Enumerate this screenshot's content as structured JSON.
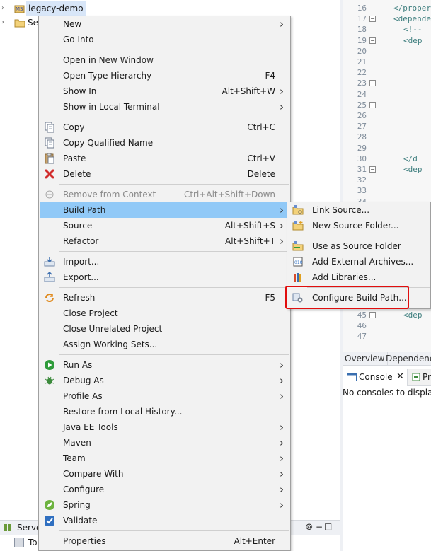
{
  "explorer": {
    "items": [
      {
        "label": "legacy-demo",
        "icon": "maven-project-icon"
      },
      {
        "label": "Se",
        "icon": "folder-icon"
      }
    ]
  },
  "editor": {
    "lines": [
      {
        "num": "16",
        "text": "</proper",
        "fold": false
      },
      {
        "num": "17",
        "text": "<depende",
        "fold": true
      },
      {
        "num": "18",
        "text": "<!--",
        "fold": false
      },
      {
        "num": "19",
        "text": "<dep",
        "fold": true
      },
      {
        "num": "20",
        "text": "",
        "fold": false
      },
      {
        "num": "21",
        "text": "",
        "fold": false
      },
      {
        "num": "22",
        "text": "",
        "fold": false
      },
      {
        "num": "23",
        "text": "",
        "fold": true
      },
      {
        "num": "24",
        "text": "",
        "fold": false
      },
      {
        "num": "25",
        "text": "",
        "fold": true
      },
      {
        "num": "26",
        "text": "",
        "fold": false
      },
      {
        "num": "27",
        "text": "",
        "fold": false
      },
      {
        "num": "28",
        "text": "",
        "fold": false
      },
      {
        "num": "29",
        "text": "",
        "fold": false
      },
      {
        "num": "30",
        "text": "</d",
        "fold": false
      },
      {
        "num": "31",
        "text": "<dep",
        "fold": true
      },
      {
        "num": "32",
        "text": "",
        "fold": false
      },
      {
        "num": "33",
        "text": "",
        "fold": false
      },
      {
        "num": "34",
        "text": "",
        "fold": false
      }
    ],
    "tail_lines": [
      {
        "num": "45",
        "text": "<dep",
        "fold": true
      },
      {
        "num": "46",
        "text": "",
        "fold": false
      },
      {
        "num": "47",
        "text": "",
        "fold": false
      }
    ],
    "tabs": [
      "Overview",
      "Dependencie"
    ]
  },
  "console": {
    "tab_label": "Console",
    "second_tab": "Pr",
    "message": "No consoles to display"
  },
  "bottom": {
    "tab_label": "Serve",
    "row_label": "To"
  },
  "context_menu": {
    "groups": [
      [
        {
          "label": "New",
          "accel": "",
          "submenu": true,
          "icon": ""
        },
        {
          "label": "Go Into",
          "accel": "",
          "submenu": false,
          "icon": ""
        }
      ],
      [
        {
          "label": "Open in New Window",
          "accel": "",
          "submenu": false,
          "icon": ""
        },
        {
          "label": "Open Type Hierarchy",
          "accel": "F4",
          "submenu": false,
          "icon": ""
        },
        {
          "label": "Show In",
          "accel": "Alt+Shift+W",
          "submenu": true,
          "icon": ""
        },
        {
          "label": "Show in Local Terminal",
          "accel": "",
          "submenu": true,
          "icon": ""
        }
      ],
      [
        {
          "label": "Copy",
          "accel": "Ctrl+C",
          "submenu": false,
          "icon": "copy-icon"
        },
        {
          "label": "Copy Qualified Name",
          "accel": "",
          "submenu": false,
          "icon": "copy-icon"
        },
        {
          "label": "Paste",
          "accel": "Ctrl+V",
          "submenu": false,
          "icon": "paste-icon"
        },
        {
          "label": "Delete",
          "accel": "Delete",
          "submenu": false,
          "icon": "delete-icon"
        }
      ],
      [
        {
          "label": "Remove from Context",
          "accel": "Ctrl+Alt+Shift+Down",
          "submenu": false,
          "icon": "remove-context-icon",
          "disabled": true
        },
        {
          "label": "Build Path",
          "accel": "",
          "submenu": true,
          "icon": "",
          "highlighted": true
        },
        {
          "label": "Source",
          "accel": "Alt+Shift+S",
          "submenu": true,
          "icon": ""
        },
        {
          "label": "Refactor",
          "accel": "Alt+Shift+T",
          "submenu": true,
          "icon": ""
        }
      ],
      [
        {
          "label": "Import...",
          "accel": "",
          "submenu": false,
          "icon": "import-icon"
        },
        {
          "label": "Export...",
          "accel": "",
          "submenu": false,
          "icon": "export-icon"
        }
      ],
      [
        {
          "label": "Refresh",
          "accel": "F5",
          "submenu": false,
          "icon": "refresh-icon"
        },
        {
          "label": "Close Project",
          "accel": "",
          "submenu": false,
          "icon": ""
        },
        {
          "label": "Close Unrelated Project",
          "accel": "",
          "submenu": false,
          "icon": ""
        },
        {
          "label": "Assign Working Sets...",
          "accel": "",
          "submenu": false,
          "icon": ""
        }
      ],
      [
        {
          "label": "Run As",
          "accel": "",
          "submenu": true,
          "icon": "run-icon"
        },
        {
          "label": "Debug As",
          "accel": "",
          "submenu": true,
          "icon": "debug-icon"
        },
        {
          "label": "Profile As",
          "accel": "",
          "submenu": true,
          "icon": ""
        },
        {
          "label": "Restore from Local History...",
          "accel": "",
          "submenu": false,
          "icon": ""
        },
        {
          "label": "Java EE Tools",
          "accel": "",
          "submenu": true,
          "icon": ""
        },
        {
          "label": "Maven",
          "accel": "",
          "submenu": true,
          "icon": ""
        },
        {
          "label": "Team",
          "accel": "",
          "submenu": true,
          "icon": ""
        },
        {
          "label": "Compare With",
          "accel": "",
          "submenu": true,
          "icon": ""
        },
        {
          "label": "Configure",
          "accel": "",
          "submenu": true,
          "icon": ""
        },
        {
          "label": "Spring",
          "accel": "",
          "submenu": true,
          "icon": "spring-icon"
        },
        {
          "label": "Validate",
          "accel": "",
          "submenu": false,
          "icon": "check-icon"
        }
      ],
      [
        {
          "label": "Properties",
          "accel": "Alt+Enter",
          "submenu": false,
          "icon": ""
        }
      ]
    ]
  },
  "build_path_submenu": {
    "groups": [
      [
        {
          "label": "Link Source...",
          "icon": "link-source-icon"
        },
        {
          "label": "New Source Folder...",
          "icon": "new-source-folder-icon"
        }
      ],
      [
        {
          "label": "Use as Source Folder",
          "icon": "use-source-folder-icon"
        },
        {
          "label": "Add External Archives...",
          "icon": "add-archive-icon"
        },
        {
          "label": "Add Libraries...",
          "icon": "add-library-icon"
        }
      ],
      [
        {
          "label": "Configure Build Path...",
          "icon": "configure-build-path-icon",
          "focused": true
        }
      ]
    ]
  },
  "colors": {
    "menu_bg": "#f2f2f2",
    "highlight": "#91c9f7",
    "focus_box": "#e10e0e",
    "disabled_text": "#8a8a8a"
  }
}
